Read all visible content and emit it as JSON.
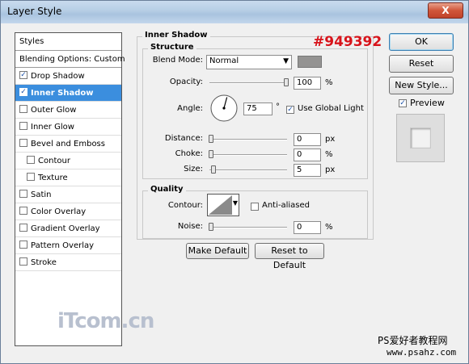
{
  "window": {
    "title": "Layer Style",
    "close": "X"
  },
  "styles_panel": {
    "header": "Styles",
    "blending": "Blending Options: Custom",
    "items": [
      {
        "label": "Drop Shadow",
        "checked": true,
        "selected": false,
        "indent": false
      },
      {
        "label": "Inner Shadow",
        "checked": true,
        "selected": true,
        "indent": false
      },
      {
        "label": "Outer Glow",
        "checked": false,
        "selected": false,
        "indent": false
      },
      {
        "label": "Inner Glow",
        "checked": false,
        "selected": false,
        "indent": false
      },
      {
        "label": "Bevel and Emboss",
        "checked": false,
        "selected": false,
        "indent": false
      },
      {
        "label": "Contour",
        "checked": false,
        "selected": false,
        "indent": true
      },
      {
        "label": "Texture",
        "checked": false,
        "selected": false,
        "indent": true
      },
      {
        "label": "Satin",
        "checked": false,
        "selected": false,
        "indent": false
      },
      {
        "label": "Color Overlay",
        "checked": false,
        "selected": false,
        "indent": false
      },
      {
        "label": "Gradient Overlay",
        "checked": false,
        "selected": false,
        "indent": false
      },
      {
        "label": "Pattern Overlay",
        "checked": false,
        "selected": false,
        "indent": false
      },
      {
        "label": "Stroke",
        "checked": false,
        "selected": false,
        "indent": false
      }
    ]
  },
  "inner_shadow": {
    "title": "Inner Shadow",
    "structure": "Structure",
    "blend_mode_label": "Blend Mode:",
    "blend_mode_value": "Normal",
    "swatch_color": "#949392",
    "opacity_label": "Opacity:",
    "opacity_value": "100",
    "opacity_unit": "%",
    "angle_label": "Angle:",
    "angle_value": "75",
    "angle_unit": "°",
    "global_light_label": "Use Global Light",
    "global_light_checked": true,
    "distance_label": "Distance:",
    "distance_value": "0",
    "distance_unit": "px",
    "choke_label": "Choke:",
    "choke_value": "0",
    "choke_unit": "%",
    "size_label": "Size:",
    "size_value": "5",
    "size_unit": "px",
    "quality": "Quality",
    "contour_label": "Contour:",
    "anti_aliased_label": "Anti-aliased",
    "noise_label": "Noise:",
    "noise_value": "0",
    "noise_unit": "%",
    "make_default": "Make Default",
    "reset_default": "Reset to Default"
  },
  "buttons": {
    "ok": "OK",
    "reset": "Reset",
    "new_style": "New Style...",
    "preview": "Preview"
  },
  "annotation": "#949392",
  "watermarks": {
    "itcomcn": "iTcom.cn",
    "site_cn": "PS爱好者教程网",
    "site_url": "www.psahz.com"
  }
}
